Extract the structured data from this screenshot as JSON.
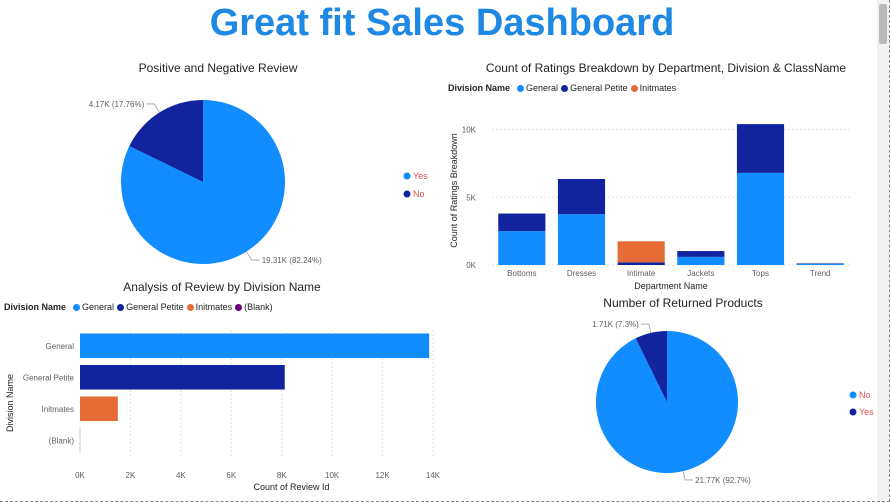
{
  "dashboard": {
    "title": "Great fit Sales Dashboard"
  },
  "colors": {
    "general": "#118DFF",
    "general_petite": "#12239E",
    "initmates": "#E66C37",
    "blank": "#6B007B",
    "pie_yes": "#118DFF",
    "pie_no": "#12239E",
    "title": "#1E88E5"
  },
  "chart_data": [
    {
      "type": "pie",
      "title": "Positive and Negative Review",
      "slices": [
        {
          "label": "Yes",
          "value": 19310,
          "percent": 82.24,
          "data_label": "19.31K (82.24%)"
        },
        {
          "label": "No",
          "value": 4170,
          "percent": 17.76,
          "data_label": "4.17K (17.76%)"
        }
      ],
      "legend": [
        "Yes",
        "No"
      ],
      "legend_position": "right"
    },
    {
      "type": "bar",
      "stacked": true,
      "title": "Count of Ratings Breakdown by Department, Division & ClassName",
      "legend_title": "Division Name",
      "legend": [
        "General",
        "General Petite",
        "Initmates"
      ],
      "categories": [
        "Bottoms",
        "Dresses",
        "Intimate",
        "Jackets",
        "Tops",
        "Trend"
      ],
      "series": [
        {
          "name": "General",
          "values": [
            2500,
            3750,
            0,
            600,
            6800,
            80
          ]
        },
        {
          "name": "General Petite",
          "values": [
            1300,
            2600,
            200,
            430,
            3600,
            40
          ]
        },
        {
          "name": "Initmates",
          "values": [
            0,
            0,
            1550,
            0,
            0,
            0
          ]
        }
      ],
      "xlabel": "Department Name",
      "ylabel": "Count of Ratings Breakdown",
      "ylim": [
        0,
        11000
      ],
      "yticks": [
        0,
        5000,
        10000
      ],
      "ytick_labels": [
        "0K",
        "5K",
        "10K"
      ]
    },
    {
      "type": "bar",
      "orientation": "horizontal",
      "title": "Analysis of Review by Division Name",
      "legend_title": "Division Name",
      "legend": [
        "General",
        "General Petite",
        "Initmates",
        "(Blank)"
      ],
      "categories": [
        "General",
        "General Petite",
        "Initmates",
        "(Blank)"
      ],
      "values": [
        13850,
        8120,
        1500,
        0
      ],
      "xlabel": "Count of Review Id",
      "ylabel": "Division Name",
      "xlim": [
        0,
        14000
      ],
      "xticks": [
        0,
        2000,
        4000,
        6000,
        8000,
        10000,
        12000,
        14000
      ],
      "xtick_labels": [
        "0K",
        "2K",
        "4K",
        "6K",
        "8K",
        "10K",
        "12K",
        "14K"
      ]
    },
    {
      "type": "pie",
      "title": "Number of Returned Products",
      "slices": [
        {
          "label": "No",
          "value": 21770,
          "percent": 92.7,
          "data_label": "21.77K (92.7%)"
        },
        {
          "label": "Yes",
          "value": 1710,
          "percent": 7.3,
          "data_label": "1.71K (7.3%)"
        }
      ],
      "legend": [
        "No",
        "Yes"
      ],
      "legend_position": "right"
    }
  ]
}
